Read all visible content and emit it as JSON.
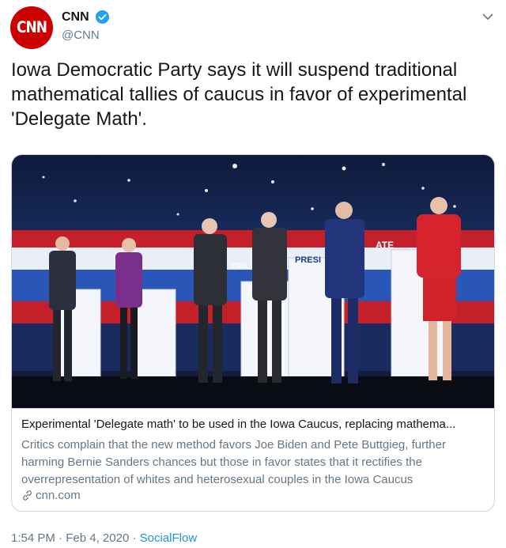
{
  "author": {
    "name": "CNN",
    "handle": "@CNN",
    "avatar_text": "CNN",
    "verified": true,
    "avatar_color": "#cc0000",
    "verified_color": "#1da1f2"
  },
  "tweet": {
    "text": "Iowa Democratic Party says it will suspend traditional mathematical tallies of caucus in favor of experimental 'Delegate Math'."
  },
  "card": {
    "image_signs": [
      "CNN",
      "PRESI",
      "ATE",
      "CNN"
    ],
    "title": "Experimental 'Delegate math' to be used in the Iowa Caucus, replacing mathema...",
    "description": "Critics complain that the new method favors Joe Biden and Pete Buttgieg, further harming Bernie Sanders chances but those in favor states that it rectifies the overrepresentation of whites and heterosexual couples in the Iowa Caucus",
    "domain": "cnn.com"
  },
  "meta": {
    "time": "1:54 PM",
    "sep1": " · ",
    "date": "Feb 4, 2020",
    "sep2": " · ",
    "source": "SocialFlow"
  },
  "colors": {
    "text": "#14171a",
    "secondary": "#657786",
    "link": "#1b95e0",
    "border": "#ccd6dd"
  }
}
